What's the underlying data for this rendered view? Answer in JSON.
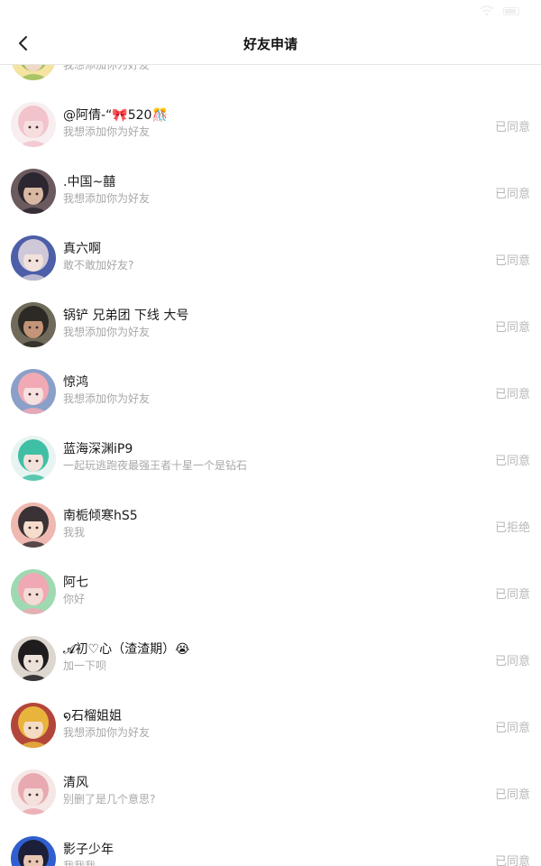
{
  "header": {
    "title": "好友申请"
  },
  "requests": [
    {
      "name": "",
      "message": "我想添加你为好友",
      "status": "",
      "avatar": {
        "skin": "#f1d9c4",
        "hair": "#9bbf5a",
        "bg": "#f4e3a1"
      }
    },
    {
      "name": "@阿倩-“🎀520🎊",
      "message": "我想添加你为好友",
      "status": "已同意",
      "avatar": {
        "skin": "#f6dede",
        "hair": "#f3c3cc",
        "bg": "#f7eef0"
      }
    },
    {
      "name": ".中国~囍",
      "message": "我想添加你为好友",
      "status": "已同意",
      "avatar": {
        "skin": "#d8b8a2",
        "hair": "#2b2630",
        "bg": "#6b5a5e"
      }
    },
    {
      "name": "真六啊",
      "message": "敢不敢加好友?",
      "status": "已同意",
      "avatar": {
        "skin": "#f2e2dc",
        "hair": "#cfc8d8",
        "bg": "#4c5fa8"
      }
    },
    {
      "name": "锅铲  兄弟团 下线  大号",
      "message": "我想添加你为好友",
      "status": "已同意",
      "avatar": {
        "skin": "#c39477",
        "hair": "#2d2a26",
        "bg": "#6f6a5a"
      }
    },
    {
      "name": "惊鸿",
      "message": "我想添加你为好友",
      "status": "已同意",
      "avatar": {
        "skin": "#f6e0e0",
        "hair": "#f2a9b6",
        "bg": "#8aa0c8"
      }
    },
    {
      "name": "蓝海深渊iP9",
      "message": "一起玩逃跑夜最强王者十星一个是钻石",
      "status": "已同意",
      "avatar": {
        "skin": "#f3e2dc",
        "hair": "#3fbfa4",
        "bg": "#e8f4f1"
      }
    },
    {
      "name": "南栀倾寒hS5",
      "message": "我我",
      "status": "已拒绝",
      "avatar": {
        "skin": "#f5dccb",
        "hair": "#3b3236",
        "bg": "#efb8b0"
      }
    },
    {
      "name": "阿七",
      "message": "你好",
      "status": "已同意",
      "avatar": {
        "skin": "#f4dcd6",
        "hair": "#f0a8b4",
        "bg": "#9fd9b2"
      }
    },
    {
      "name": "𝓐初♡心（渣渣期）😭",
      "message": "加一下呗",
      "status": "已同意",
      "avatar": {
        "skin": "#ede2da",
        "hair": "#1f1c1e",
        "bg": "#dcd6cf"
      }
    },
    {
      "name": "໑石榴姐姐",
      "message": "我想添加你为好友",
      "status": "已同意",
      "avatar": {
        "skin": "#f4dcc4",
        "hair": "#e9b43c",
        "bg": "#b3463a"
      }
    },
    {
      "name": "清风",
      "message": "别删了是几个意思?",
      "status": "已同意",
      "avatar": {
        "skin": "#f4e0dc",
        "hair": "#e9a9b0",
        "bg": "#f5e7e6"
      }
    },
    {
      "name": "影子少年",
      "message": "我我我",
      "status": "已同意",
      "avatar": {
        "skin": "#e7c6b3",
        "hair": "#1b1f3a",
        "bg": "#2f5fd0"
      }
    }
  ]
}
